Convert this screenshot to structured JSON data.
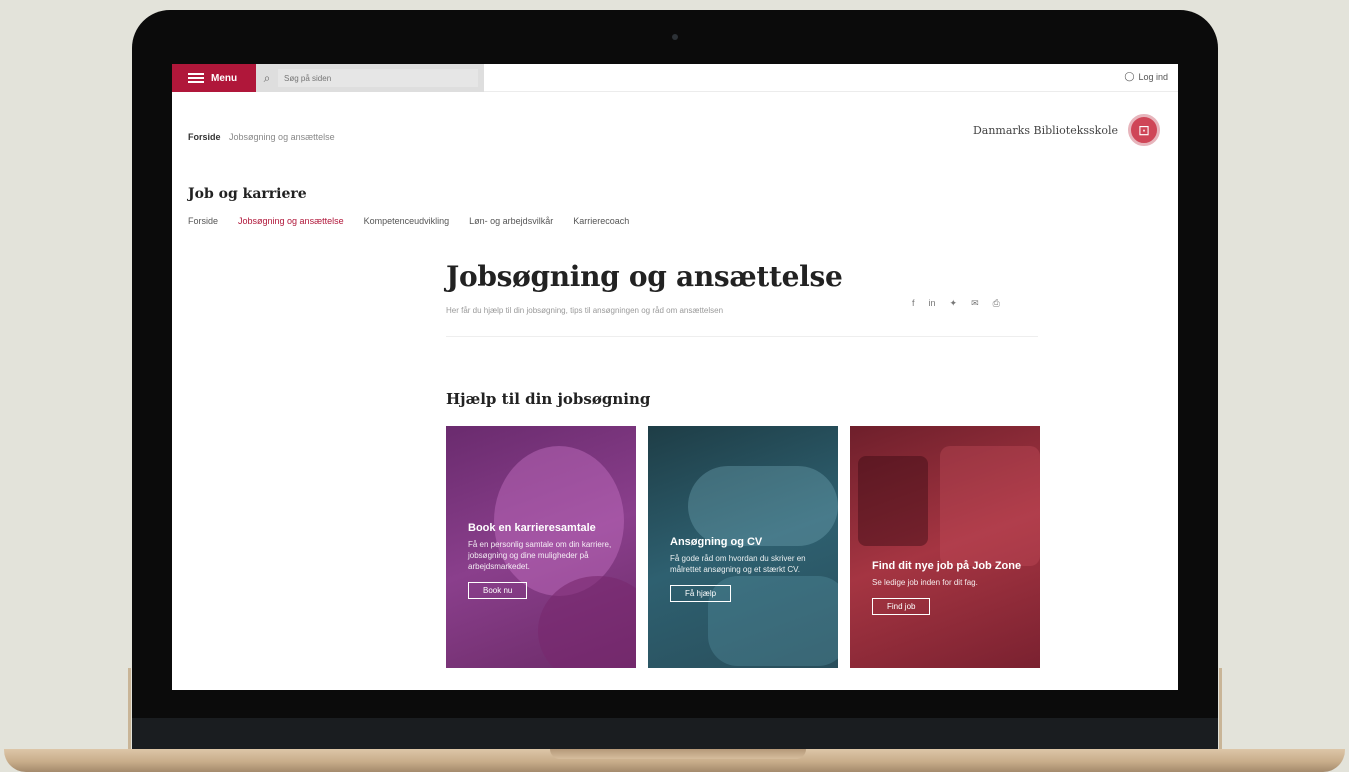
{
  "topbar": {
    "menu_label": "Menu",
    "search_placeholder": "Søg på siden",
    "login_label": "Log ind",
    "menu_color": "#b0173a"
  },
  "breadcrumb": {
    "home": "Forside",
    "trail": "Jobsøgning og ansættelse"
  },
  "brand": {
    "name": "Danmarks Biblioteksskole",
    "logo_icon": "circle-emblem-icon"
  },
  "section": {
    "title": "Job og karriere",
    "tabs": [
      {
        "label": "Forside",
        "active": false
      },
      {
        "label": "Jobsøgning og ansættelse",
        "active": true
      },
      {
        "label": "Kompetenceudvikling",
        "active": false
      },
      {
        "label": "Løn- og arbejdsvilkår",
        "active": false
      },
      {
        "label": "Karrierecoach",
        "active": false
      }
    ]
  },
  "page": {
    "title": "Jobsøgning og ansættelse",
    "lead": "Her får du hjælp til din jobsøgning, tips til ansøgningen og råd om ansættelsen",
    "share_icons": [
      "facebook-icon",
      "linkedin-icon",
      "twitter-icon",
      "mail-icon",
      "print-icon"
    ]
  },
  "help": {
    "title": "Hjælp til din jobsøgning",
    "cards": [
      {
        "title": "Book en karrieresamtale",
        "text": "Få en personlig samtale om din karriere, jobsøgning og dine muligheder på arbejdsmarkedet.",
        "button": "Book nu",
        "color": "#7a3478"
      },
      {
        "title": "Ansøgning og CV",
        "text": "Få gode råd om hvordan du skriver en målrettet ansøgning og et stærkt CV.",
        "button": "Få hjælp",
        "color": "#2e6070"
      },
      {
        "title": "Find dit nye job på Job Zone",
        "text": "Se ledige job inden for dit fag.",
        "button": "Find job",
        "color": "#a53542"
      }
    ]
  }
}
